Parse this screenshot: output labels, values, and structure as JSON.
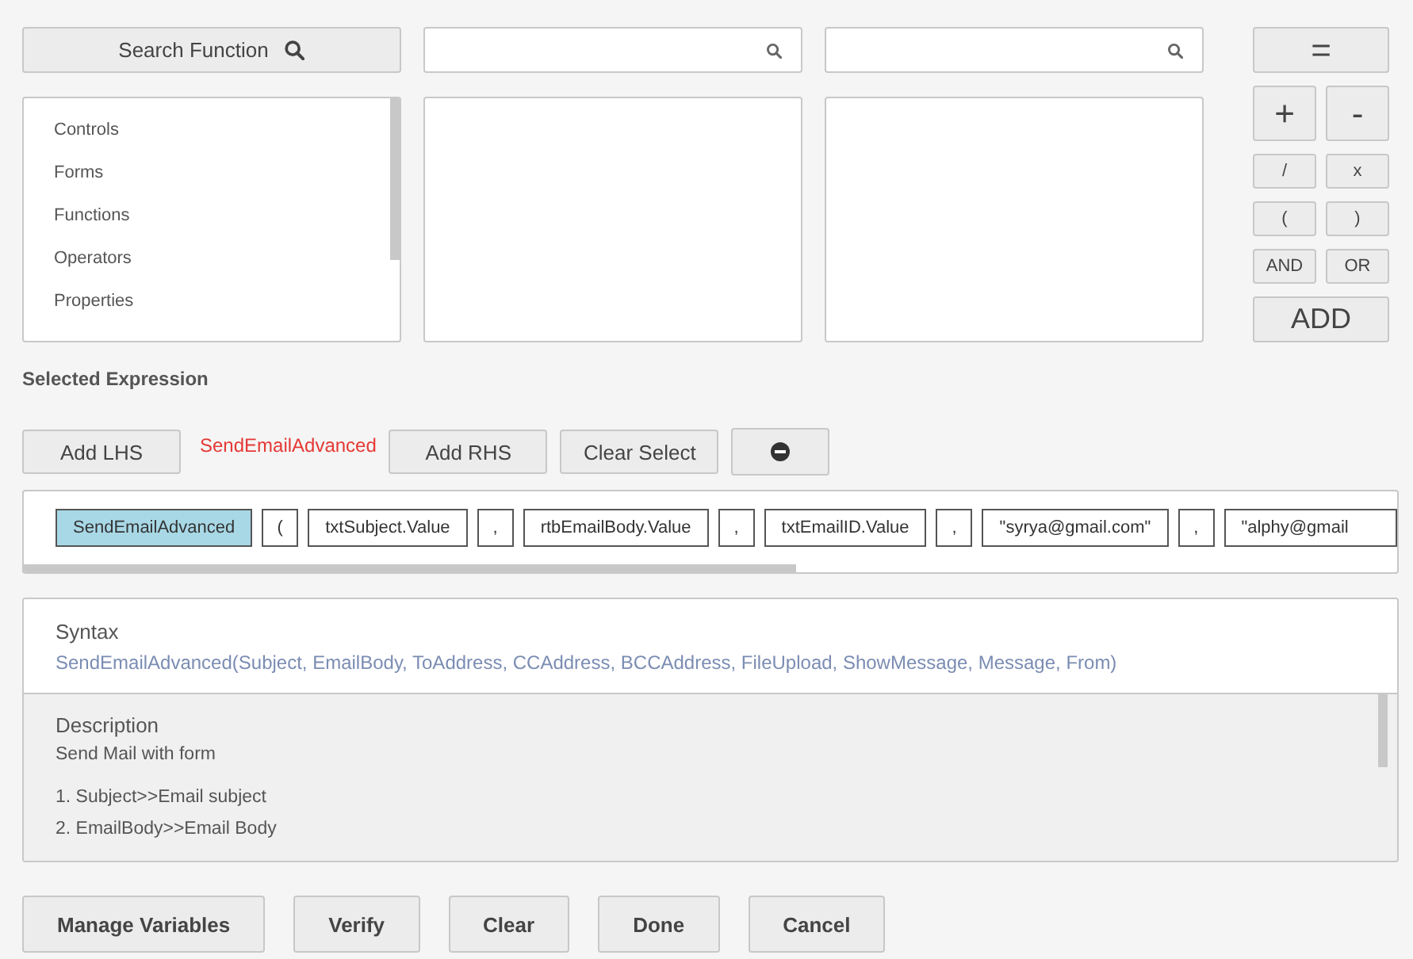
{
  "search_button": {
    "label": "Search Function"
  },
  "categories": [
    {
      "label": "Controls",
      "selected": false
    },
    {
      "label": "Forms",
      "selected": false
    },
    {
      "label": "Functions",
      "selected": false
    },
    {
      "label": "Operators",
      "selected": false
    },
    {
      "label": "Properties",
      "selected": false
    }
  ],
  "operators": {
    "equals": "=",
    "rows": [
      [
        "+",
        "-"
      ],
      [
        "/",
        "x"
      ],
      [
        "(",
        ")"
      ],
      [
        "AND",
        "OR"
      ]
    ],
    "add": "ADD"
  },
  "selected_expression": {
    "title": "Selected Expression",
    "add_lhs": "Add LHS",
    "current": "SendEmailAdvanced",
    "add_rhs": "Add RHS",
    "clear_select": "Clear Select"
  },
  "tokens": [
    {
      "text": "SendEmailAdvanced",
      "selected": true
    },
    {
      "text": "(",
      "selected": false
    },
    {
      "text": "txtSubject.Value",
      "selected": false
    },
    {
      "text": ",",
      "selected": false
    },
    {
      "text": "rtbEmailBody.Value",
      "selected": false
    },
    {
      "text": ",",
      "selected": false
    },
    {
      "text": "txtEmailID.Value",
      "selected": false
    },
    {
      "text": ",",
      "selected": false
    },
    {
      "text": "\"syrya@gmail.com\"",
      "selected": false
    },
    {
      "text": ",",
      "selected": false
    },
    {
      "text": "\"alphy@gmail",
      "selected": false
    }
  ],
  "syntax": {
    "title": "Syntax",
    "text": "SendEmailAdvanced(Subject, EmailBody, ToAddress, CCAddress, BCCAddress, FileUpload, ShowMessage, Message, From)"
  },
  "description": {
    "title": "Description",
    "summary": "Send Mail with form",
    "params": [
      "1. Subject>>Email subject",
      "2. EmailBody>>Email Body"
    ]
  },
  "footer_buttons": [
    "Manage Variables",
    "Verify",
    "Clear",
    "Done",
    "Cancel"
  ]
}
